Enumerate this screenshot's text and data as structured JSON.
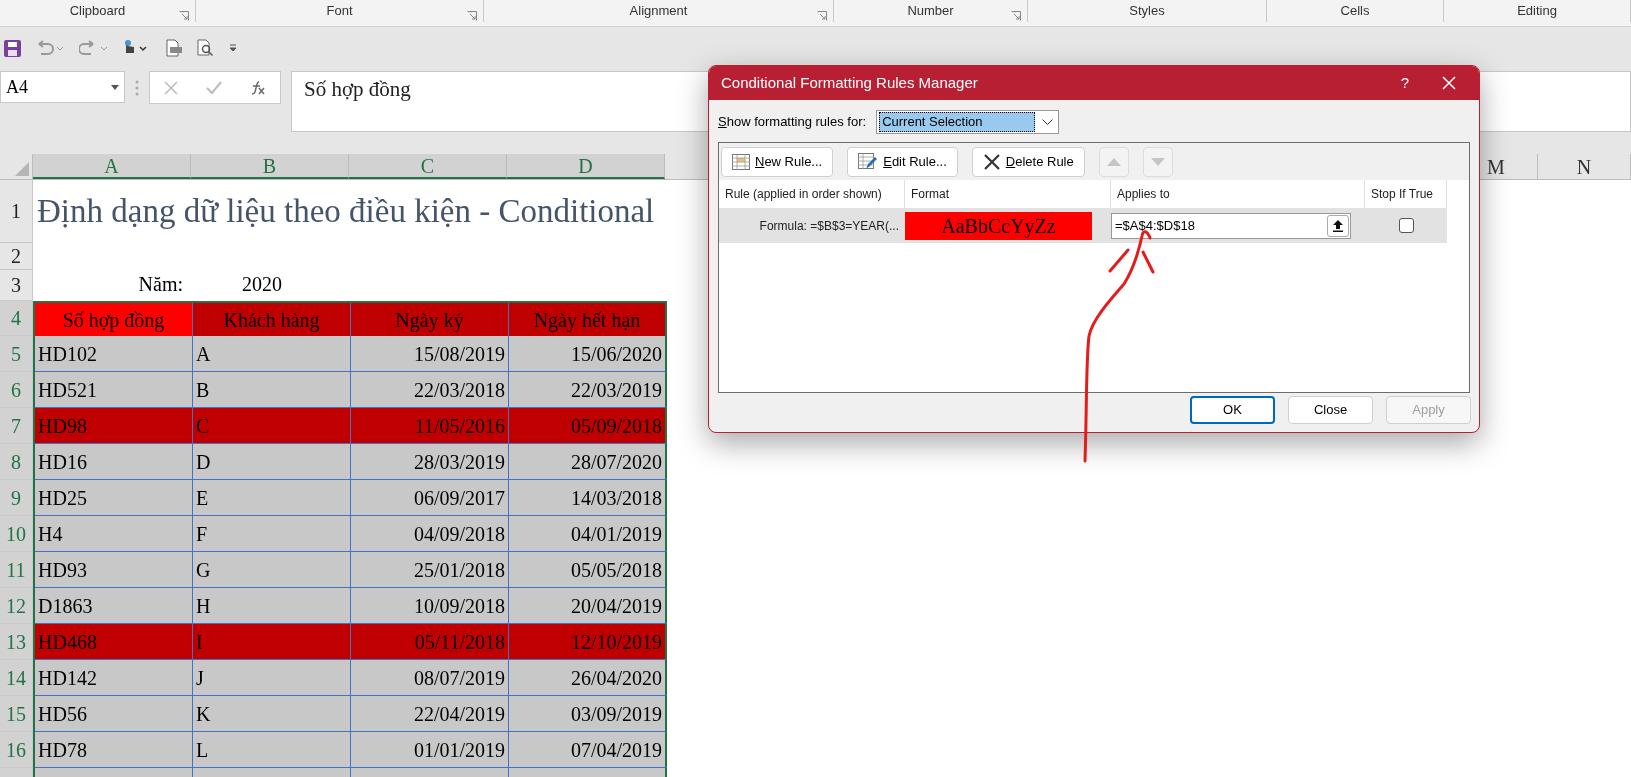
{
  "ribbon_groups": [
    {
      "label": "Clipboard",
      "launcher": true
    },
    {
      "label": "Font",
      "launcher": true
    },
    {
      "label": "Alignment",
      "launcher": true
    },
    {
      "label": "Number",
      "launcher": true
    },
    {
      "label": "Styles",
      "launcher": false
    },
    {
      "label": "Cells",
      "launcher": false
    },
    {
      "label": "Editing",
      "launcher": false
    }
  ],
  "name_box": {
    "value": "A4"
  },
  "formula_bar": {
    "value": "Số hợp đồng"
  },
  "sheet": {
    "column_headers": [
      "A",
      "B",
      "C",
      "D",
      "M",
      "N"
    ],
    "row_numbers": [
      "1",
      "2",
      "3",
      "4",
      "5",
      "6",
      "7",
      "8",
      "9",
      "10",
      "11",
      "12",
      "13",
      "14",
      "15",
      "16"
    ],
    "title": "Định dạng dữ liệu theo điều kiện - Conditional",
    "year_label": "Năm:",
    "year_value": "2020",
    "table": {
      "columns": [
        {
          "label": "Số hợp đồng",
          "active": true
        },
        {
          "label": "Khách hàng",
          "active": false
        },
        {
          "label": "Ngày ký",
          "active": false
        },
        {
          "label": "Ngày hết hạn",
          "active": false
        }
      ],
      "rows": [
        {
          "cells": [
            "HD102",
            "A",
            "15/08/2019",
            "15/06/2020"
          ],
          "highlighted": false
        },
        {
          "cells": [
            "HD521",
            "B",
            "22/03/2018",
            "22/03/2019"
          ],
          "highlighted": false
        },
        {
          "cells": [
            "HD98",
            "C",
            "11/05/2016",
            "05/09/2018"
          ],
          "highlighted": true
        },
        {
          "cells": [
            "HD16",
            "D",
            "28/03/2019",
            "28/07/2020"
          ],
          "highlighted": false
        },
        {
          "cells": [
            "HD25",
            "E",
            "06/09/2017",
            "14/03/2018"
          ],
          "highlighted": false
        },
        {
          "cells": [
            "H4",
            "F",
            "04/09/2018",
            "04/01/2019"
          ],
          "highlighted": false
        },
        {
          "cells": [
            "HD93",
            "G",
            "25/01/2018",
            "05/05/2018"
          ],
          "highlighted": false
        },
        {
          "cells": [
            "D1863",
            "H",
            "10/09/2018",
            "20/04/2019"
          ],
          "highlighted": false
        },
        {
          "cells": [
            "HD468",
            "I",
            "05/11/2018",
            "12/10/2019"
          ],
          "highlighted": true
        },
        {
          "cells": [
            "HD142",
            "J",
            "08/07/2019",
            "26/04/2020"
          ],
          "highlighted": false
        },
        {
          "cells": [
            "HD56",
            "K",
            "22/04/2019",
            "03/09/2019"
          ],
          "highlighted": false
        },
        {
          "cells": [
            "HD78",
            "L",
            "01/01/2019",
            "07/04/2019"
          ],
          "highlighted": false
        }
      ]
    }
  },
  "dialog": {
    "title": "Conditional Formatting Rules Manager",
    "help": "?",
    "show_label": "Show formatting rules for:",
    "show_value": "Current Selection",
    "toolbar": [
      {
        "kind": "new",
        "label": "New Rule...",
        "disabled": false
      },
      {
        "kind": "edit",
        "label": "Edit Rule...",
        "disabled": false
      },
      {
        "kind": "delete",
        "label": "Delete Rule",
        "disabled": false
      },
      {
        "kind": "up",
        "disabled": true
      },
      {
        "kind": "down",
        "disabled": true
      }
    ],
    "columns": [
      "Rule (applied in order shown)",
      "Format",
      "Applies to",
      "Stop If True"
    ],
    "rules": [
      {
        "rule": "Formula: =$B$3=YEAR(...",
        "format_sample": "AaBbCcYyZz",
        "applies_to": "=$A$4:$D$18",
        "stop_if_true": false,
        "selected": true
      }
    ],
    "buttons": [
      {
        "label": "OK",
        "focused": true,
        "disabled": false
      },
      {
        "label": "Close",
        "focused": false,
        "disabled": false
      },
      {
        "label": "Apply",
        "focused": false,
        "disabled": true
      }
    ]
  }
}
